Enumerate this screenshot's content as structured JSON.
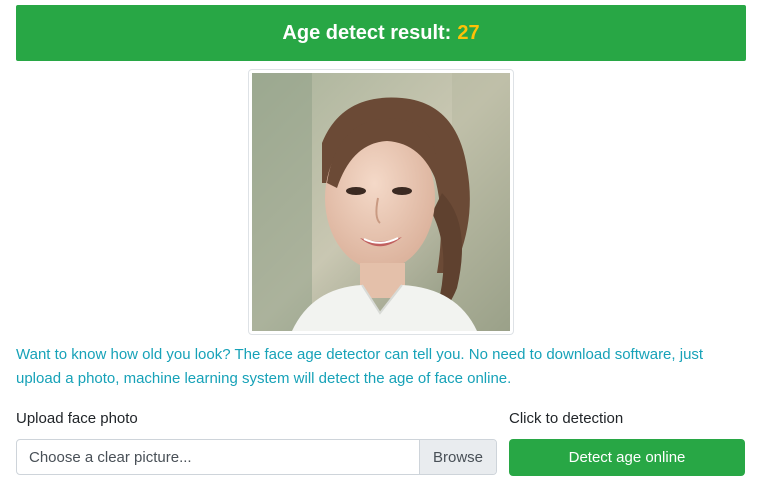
{
  "result": {
    "label": "Age detect result:",
    "age": "27"
  },
  "photo": {
    "alt": "face photo"
  },
  "description": "Want to know how old you look? The face age detector can tell you. No need to download software, just upload a photo, machine learning system will detect the age of face online.",
  "upload": {
    "label": "Upload face photo",
    "placeholder": "Choose a clear picture...",
    "browse_label": "Browse"
  },
  "detect": {
    "label": "Click to detection",
    "button_label": "Detect age online"
  },
  "colors": {
    "banner": "#28a745",
    "age_highlight": "#ffc107",
    "description_text": "#17a2b8",
    "button": "#28a745"
  }
}
